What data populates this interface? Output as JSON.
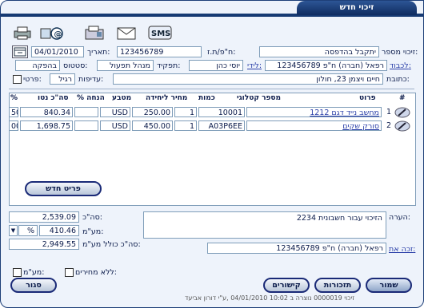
{
  "window": {
    "title": "זיכוי חדש"
  },
  "toolbar": {
    "sms_label": "SMS"
  },
  "form": {
    "credit_no_label": "זיכוי מספר:",
    "credit_no_value": "יתקבל בהדפסה",
    "vat_id_label": "ח\"פ/ת.ז:",
    "vat_id_value": "123456789",
    "date_label": "תאריך:",
    "date_value": "04/01/2010",
    "customer_label": "לכבוד:",
    "customer_value": "רפאל (חברה) ח\"פ 123456789",
    "by_label": "לידי:",
    "by_value": "יוסי כהן",
    "role_label": "תפקיד:",
    "role_value": "מנהל תפעול",
    "status_label": "סטטוס:",
    "status_value": "בהפקה",
    "address_label": "כתובת:",
    "address_value": "חיים ויצמן 23, חולון",
    "priority_label": "עדיפות:",
    "priority_value": "רגיל",
    "private_label": "פרטי:"
  },
  "table": {
    "columns": {
      "num": "#",
      "item": "פרוט",
      "catalog": "מספר קטלוגי",
      "qty": "כמות",
      "unit_price": "מחיר ליחידה",
      "currency": "מטבע",
      "discount": "% הנחה",
      "total": "סה\"כ נטו",
      "pct": "%"
    },
    "rows": [
      {
        "num": "1",
        "item": "מחשב נייד דגם 1212",
        "catalog": "10001",
        "qty": "1",
        "unit_price": "250.00",
        "currency": "USD",
        "discount": "",
        "total": "840.34",
        "pct": "50"
      },
      {
        "num": "2",
        "item": "סורק שקים",
        "catalog": "A03P6EE",
        "qty": "1",
        "unit_price": "450.00",
        "currency": "USD",
        "discount": "",
        "total": "1,698.75",
        "pct": "00"
      }
    ],
    "new_item_button": "פריט חדש"
  },
  "summary": {
    "total_label": "סה\"כ:",
    "total_value": "2,539.09",
    "vat_label": "מע\"מ:",
    "vat_value": "410.46",
    "vat_pct_value": "%",
    "grand_label": "סה\"כ כולל מע\"מ:",
    "grand_value": "2,949.55"
  },
  "remarks": {
    "label": "הערה:",
    "value": "הזיכוי עבור חשבונית 2234"
  },
  "credit_to": {
    "label": "זכה את:",
    "value": "רפאל (חברה) ח\"פ 123456789"
  },
  "options": {
    "no_prices_label": "ללא מחירים:",
    "vat_label": "מע\"מ:"
  },
  "buttons": {
    "save": "שמור",
    "reminders": "תזכורות",
    "links": "קישורים",
    "close": "סגור"
  },
  "footer": {
    "text": "זיכוי 0000019 נוצרה ב 10:02 04/01/2010 ,ע\"י דורון אביעד"
  }
}
